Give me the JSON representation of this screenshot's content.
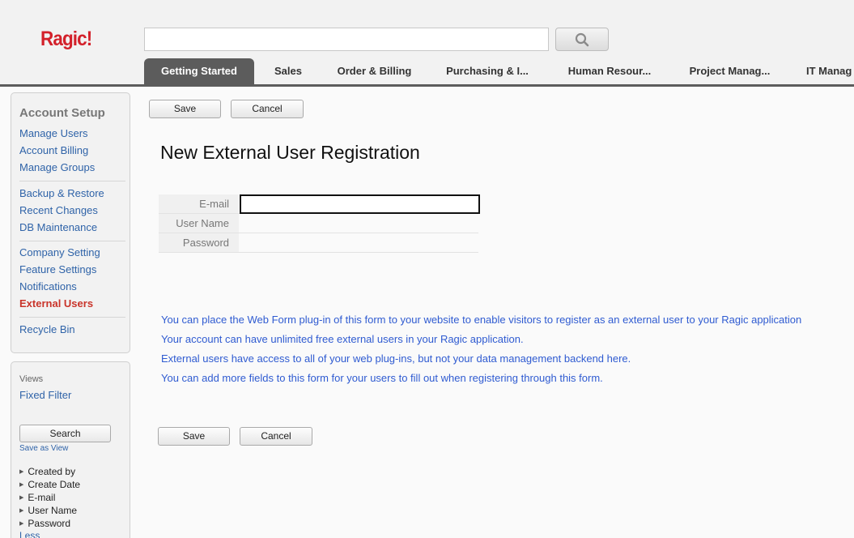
{
  "header": {
    "logo": "Ragic!",
    "search_value": "",
    "tabs": [
      {
        "label": "Getting Started"
      },
      {
        "label": "Sales"
      },
      {
        "label": "Order & Billing"
      },
      {
        "label": "Purchasing & I..."
      },
      {
        "label": "Human Resour..."
      },
      {
        "label": "Project Manag..."
      },
      {
        "label": "IT Manag"
      }
    ],
    "active_tab": 0
  },
  "sidebar": {
    "title": "Account Setup",
    "groups": [
      [
        "Manage Users",
        "Account Billing",
        "Manage Groups"
      ],
      [
        "Backup & Restore",
        "Recent Changes",
        "DB Maintenance"
      ],
      [
        "Company Setting",
        "Feature Settings",
        "Notifications",
        "External Users"
      ],
      [
        "Recycle Bin"
      ]
    ],
    "current": "External Users",
    "views_label": "Views",
    "fixed_filter": "Fixed Filter",
    "search_label": "Search",
    "save_as_view": "Save as View",
    "fields": [
      "Created by",
      "Create Date",
      "E-mail",
      "User Name",
      "Password"
    ],
    "less": "Less"
  },
  "main": {
    "save_label": "Save",
    "cancel_label": "Cancel",
    "title": "New External User Registration",
    "form": [
      {
        "label": "E-mail",
        "value": ""
      },
      {
        "label": "User Name",
        "value": ""
      },
      {
        "label": "Password",
        "value": ""
      }
    ],
    "info_lines": [
      "You can place the Web Form plug-in of this form to your website to enable visitors to register as an external user to your Ragic application",
      "Your account can have unlimited free external users in your Ragic application.",
      "External users have access to all of your web plug-ins, but not your data management backend here.",
      "You can add more fields to this form for your users to fill out when registering through this form."
    ]
  },
  "colors": {
    "logo_red": "#d3202a",
    "active_tab": "#5c5c5c",
    "link_blue": "#2f63a8",
    "current_link_red": "#c9342a",
    "info_blue": "#2f5bd1"
  }
}
